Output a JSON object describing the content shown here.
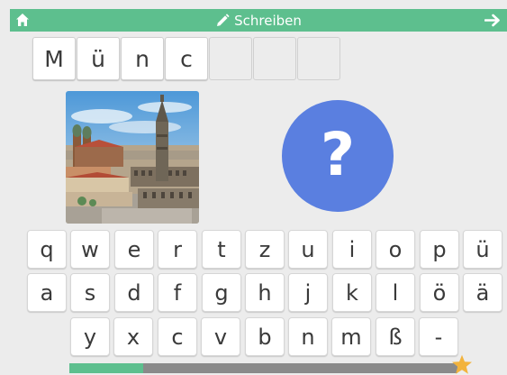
{
  "header": {
    "title": "Schreiben",
    "icons": {
      "home": "home-icon",
      "pencil": "pencil-icon",
      "next": "arrow-right-icon"
    },
    "background": "#5dbf8e"
  },
  "word_slots": [
    "M",
    "ü",
    "n",
    "c",
    "",
    "",
    ""
  ],
  "picture": {
    "subject": "Munich city view"
  },
  "help_button": {
    "label": "?",
    "color": "#5a7fe0",
    "icon": "question-icon"
  },
  "keyboard": {
    "rows": [
      [
        "q",
        "w",
        "e",
        "r",
        "t",
        "z",
        "u",
        "i",
        "o",
        "p",
        "ü"
      ],
      [
        "a",
        "s",
        "d",
        "f",
        "g",
        "h",
        "j",
        "k",
        "l",
        "ö",
        "ä"
      ],
      [
        "y",
        "x",
        "c",
        "v",
        "b",
        "n",
        "m",
        "ß",
        "-"
      ]
    ]
  },
  "progress": {
    "fraction": 0.19,
    "fill_color": "#5dbf8e",
    "track_color": "#8a8a8a",
    "end_icon": "star-icon"
  }
}
